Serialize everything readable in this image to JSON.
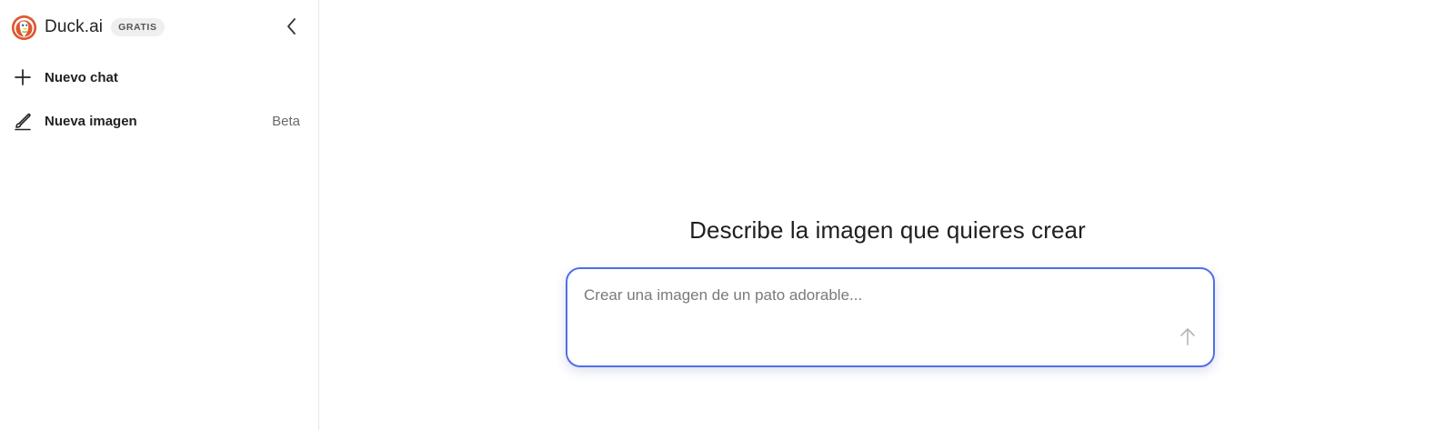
{
  "sidebar": {
    "brand": {
      "name": "Duck.ai",
      "badge": "GRATIS",
      "logo_icon": "duckduckgo-logo-icon"
    },
    "collapse_icon": "chevron-left-icon",
    "items": [
      {
        "label": "Nuevo chat",
        "icon": "plus-icon",
        "tag": ""
      },
      {
        "label": "Nueva imagen",
        "icon": "brush-icon",
        "tag": "Beta"
      }
    ]
  },
  "main": {
    "title": "Describe la imagen que quieres crear",
    "prompt": {
      "value": "",
      "placeholder": "Crear una imagen de un pato adorable...",
      "send_icon": "arrow-up-icon"
    }
  },
  "colors": {
    "accent_border": "#4f6fe8",
    "logo_orange": "#de5833",
    "sidebar_border": "#e6e6e6"
  }
}
